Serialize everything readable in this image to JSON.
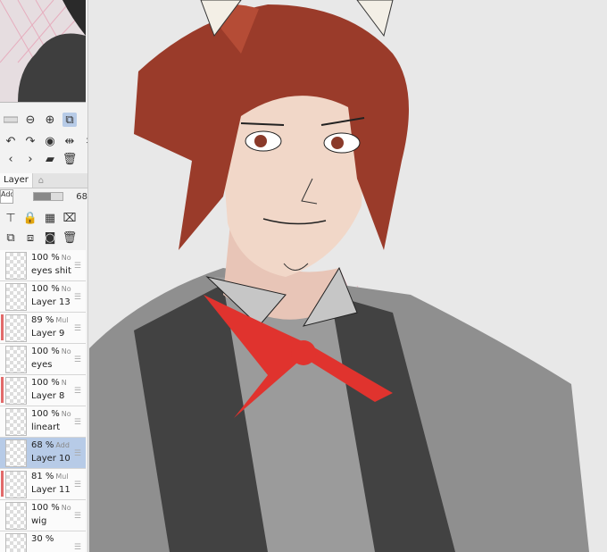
{
  "toolbar": {
    "row1": [
      "zoom-slider-icon",
      "zoom-out-icon",
      "zoom-in-icon",
      "fit-icon"
    ],
    "row2": [
      "rotate-left-icon",
      "rotate-right-icon",
      "reset-rotate-icon",
      "flip-h-icon",
      "flip-v-icon"
    ],
    "row3": [
      "prev-icon",
      "next-icon",
      "open-folder-icon",
      "trash-icon"
    ]
  },
  "layer_panel": {
    "tab_label": "Layer",
    "blend_mode": "Add",
    "opacity_value": "68"
  },
  "layers": [
    {
      "opacity": "100 %",
      "mode": "No",
      "name": "eyes shit",
      "selected": false,
      "marked": false
    },
    {
      "opacity": "100 %",
      "mode": "No",
      "name": "Layer 13",
      "selected": false,
      "marked": false
    },
    {
      "opacity": "89 %",
      "mode": "Mul",
      "name": "Layer 9",
      "selected": false,
      "marked": true
    },
    {
      "opacity": "100 %",
      "mode": "No",
      "name": "eyes",
      "selected": false,
      "marked": false
    },
    {
      "opacity": "100 %",
      "mode": "N",
      "name": "Layer 8",
      "selected": false,
      "marked": true
    },
    {
      "opacity": "100 %",
      "mode": "No",
      "name": "lineart",
      "selected": false,
      "marked": false
    },
    {
      "opacity": "68 %",
      "mode": "Add",
      "name": "Layer 10",
      "selected": true,
      "marked": false
    },
    {
      "opacity": "81 %",
      "mode": "Mul",
      "name": "Layer 11",
      "selected": false,
      "marked": true
    },
    {
      "opacity": "100 %",
      "mode": "No",
      "name": "wig",
      "selected": false,
      "marked": false
    },
    {
      "opacity": "30 %",
      "mode": "",
      "name": "",
      "selected": false,
      "marked": false
    }
  ],
  "colors": {
    "hair": "#9a3b2a",
    "skin": "#f1d7c8",
    "vest": "#3d3d3d",
    "shirt": "#8d8d8d",
    "ribbon": "#e0332e",
    "selection": "#b7cbe7"
  }
}
